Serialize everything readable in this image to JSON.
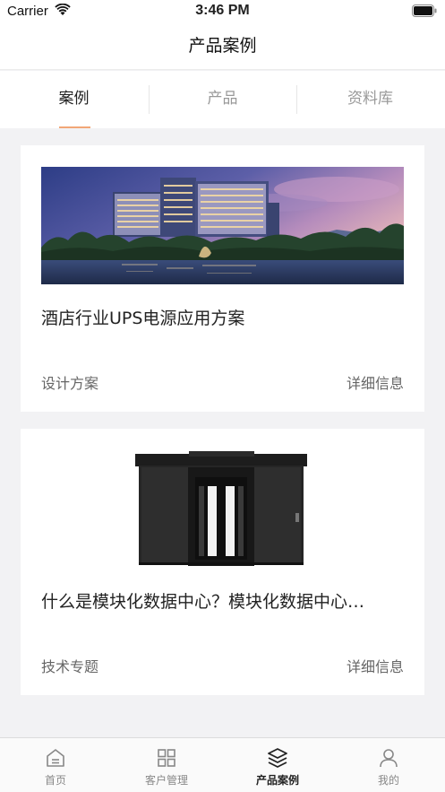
{
  "status_bar": {
    "carrier": "Carrier",
    "time": "3:46 PM"
  },
  "nav": {
    "title": "产品案例"
  },
  "tabs": [
    {
      "label": "案例",
      "active": true
    },
    {
      "label": "产品",
      "active": false
    },
    {
      "label": "资料库",
      "active": false
    }
  ],
  "cards": [
    {
      "title": "酒店行业UPS电源应用方案",
      "tag": "设计方案",
      "detail": "详细信息",
      "image": "hotel-photo"
    },
    {
      "title": "什么是模块化数据中心？模块化数据中心…",
      "tag": "技术专题",
      "detail": "详细信息",
      "image": "data-center-cabinet"
    }
  ],
  "tabbar": [
    {
      "label": "首页",
      "icon": "home-icon",
      "active": false
    },
    {
      "label": "客户管理",
      "icon": "grid-icon",
      "active": false
    },
    {
      "label": "产品案例",
      "icon": "layers-icon",
      "active": true
    },
    {
      "label": "我的",
      "icon": "person-icon",
      "active": false
    }
  ],
  "colors": {
    "accent": "#f2a777",
    "background": "#f2f2f4"
  }
}
